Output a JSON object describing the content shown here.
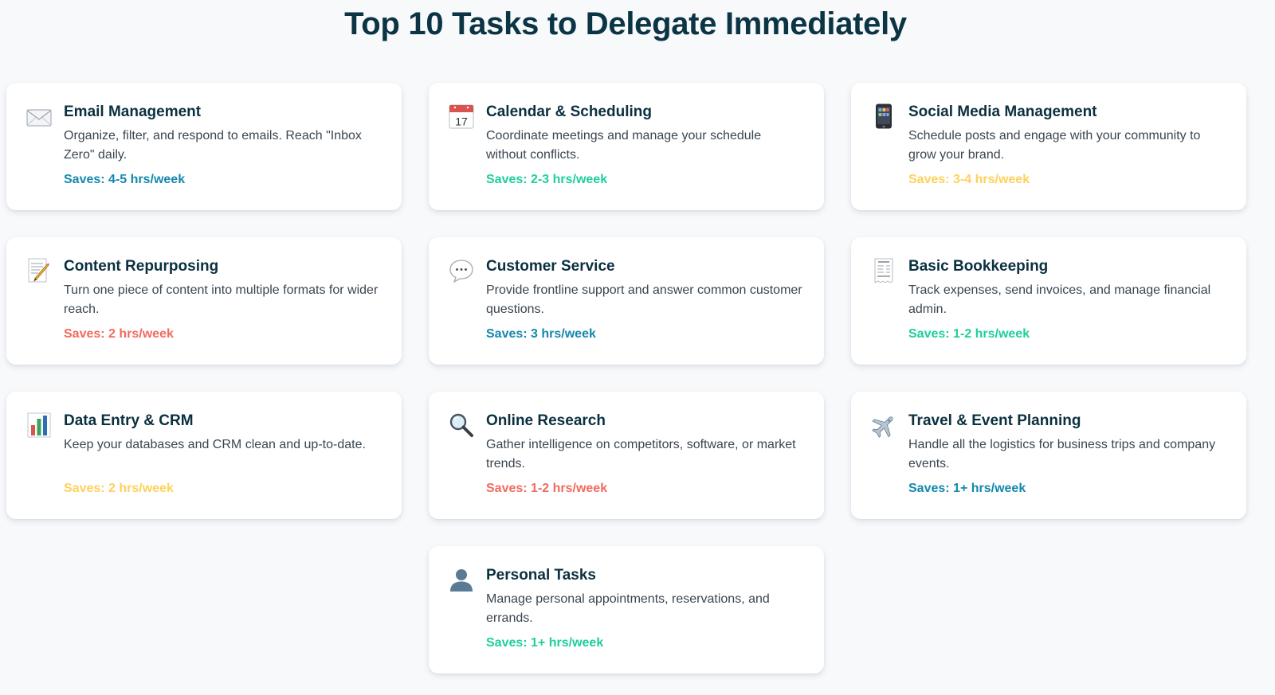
{
  "page_title": "Top 10 Tasks to Delegate Immediately",
  "colors": {
    "blue": "#1488ad",
    "green": "#1fcf9b",
    "yellow": "#ffd05c",
    "red": "#f26a5e"
  },
  "cards": [
    {
      "icon": "envelope-icon",
      "title": "Email Management",
      "description": "Organize, filter, and respond to emails. Reach \"Inbox Zero\" daily.",
      "saves": "Saves: 4-5 hrs/week",
      "saves_color": "#1488ad"
    },
    {
      "icon": "calendar-icon",
      "title": "Calendar & Scheduling",
      "description": "Coordinate meetings and manage your schedule without conflicts.",
      "saves": "Saves: 2-3 hrs/week",
      "saves_color": "#1fcf9b"
    },
    {
      "icon": "mobile-phone-icon",
      "title": "Social Media Management",
      "description": "Schedule posts and engage with your community to grow your brand.",
      "saves": "Saves: 3-4 hrs/week",
      "saves_color": "#ffd05c"
    },
    {
      "icon": "memo-icon",
      "title": "Content Repurposing",
      "description": "Turn one piece of content into multiple formats for wider reach.",
      "saves": "Saves: 2 hrs/week",
      "saves_color": "#f26a5e"
    },
    {
      "icon": "speech-bubble-icon",
      "title": "Customer Service",
      "description": "Provide frontline support and answer common customer questions.",
      "saves": "Saves: 3 hrs/week",
      "saves_color": "#1488ad"
    },
    {
      "icon": "receipt-icon",
      "title": "Basic Bookkeeping",
      "description": "Track expenses, send invoices, and manage financial admin.",
      "saves": "Saves: 1-2 hrs/week",
      "saves_color": "#1fcf9b"
    },
    {
      "icon": "bar-chart-icon",
      "title": "Data Entry & CRM",
      "description": "Keep your databases and CRM clean and up-to-date.",
      "saves": "Saves: 2 hrs/week",
      "saves_color": "#ffd05c"
    },
    {
      "icon": "magnifying-glass-icon",
      "title": "Online Research",
      "description": "Gather intelligence on competitors, software, or market trends.",
      "saves": "Saves: 1-2 hrs/week",
      "saves_color": "#f26a5e"
    },
    {
      "icon": "airplane-icon",
      "title": "Travel & Event Planning",
      "description": "Handle all the logistics for business trips and company events.",
      "saves": "Saves: 1+ hrs/week",
      "saves_color": "#1488ad"
    },
    {
      "icon": "person-silhouette-icon",
      "title": "Personal Tasks",
      "description": "Manage personal appointments, reservations, and errands.",
      "saves": "Saves: 1+ hrs/week",
      "saves_color": "#1fcf9b"
    }
  ]
}
